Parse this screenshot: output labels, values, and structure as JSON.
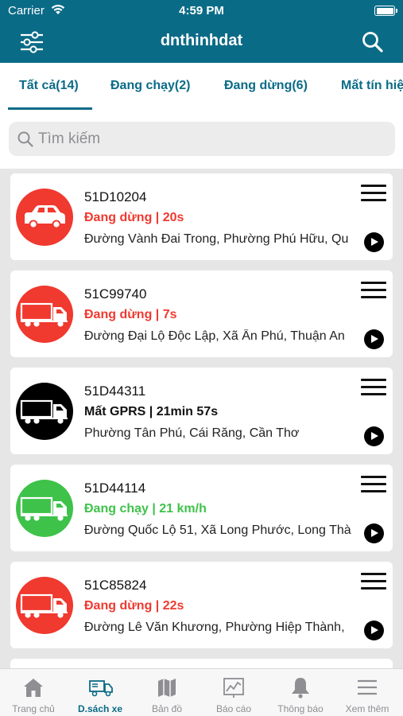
{
  "status_bar": {
    "carrier": "Carrier",
    "time": "4:59 PM"
  },
  "header": {
    "title": "dnthinhdat",
    "filter_icon": "sliders-icon",
    "search_icon": "search-icon"
  },
  "tabs": [
    {
      "label": "Tất cả(14)",
      "active": true
    },
    {
      "label": "Đang chạy(2)",
      "active": false
    },
    {
      "label": "Đang dừng(6)",
      "active": false
    },
    {
      "label": "Mất tín hiệu",
      "active": false
    }
  ],
  "search": {
    "placeholder": "Tìm kiếm",
    "value": ""
  },
  "colors": {
    "primary": "#0a6b87",
    "stopped": "#f0392f",
    "running": "#3ec24a",
    "lost": "#000000"
  },
  "vehicles": [
    {
      "plate": "51D10204",
      "status": "Đang dừng | 20s",
      "status_type": "stopped",
      "address": "Đường Vành Đai Trong, Phường Phú Hữu, Qu",
      "icon": "car-icon"
    },
    {
      "plate": "51C99740",
      "status": "Đang dừng | 7s",
      "status_type": "stopped",
      "address": "Đường Đại Lộ Độc Lập, Xã Ân Phú, Thuận An",
      "icon": "truck-icon"
    },
    {
      "plate": "51D44311",
      "status": "Mất GPRS | 21min 57s",
      "status_type": "lost",
      "address": "Phường Tân Phú, Cái Răng, Cần Thơ",
      "icon": "truck-icon"
    },
    {
      "plate": "51D44114",
      "status": "Đang chạy | 21 km/h",
      "status_type": "running",
      "address": "Đường Quốc Lộ 51, Xã Long Phước, Long Thà",
      "icon": "truck-icon"
    },
    {
      "plate": "51C85824",
      "status": "Đang dừng | 22s",
      "status_type": "stopped",
      "address": "Đường Lê Văn Khương, Phường Hiệp Thành,",
      "icon": "truck-icon"
    }
  ],
  "bottom_nav": [
    {
      "label": "Trang chủ",
      "icon": "home-icon",
      "active": false
    },
    {
      "label": "D.sách xe",
      "icon": "truck-list-icon",
      "active": true
    },
    {
      "label": "Bản đồ",
      "icon": "map-icon",
      "active": false
    },
    {
      "label": "Báo cáo",
      "icon": "chart-icon",
      "active": false
    },
    {
      "label": "Thông báo",
      "icon": "bell-icon",
      "active": false
    },
    {
      "label": "Xem thêm",
      "icon": "menu-icon",
      "active": false
    }
  ]
}
